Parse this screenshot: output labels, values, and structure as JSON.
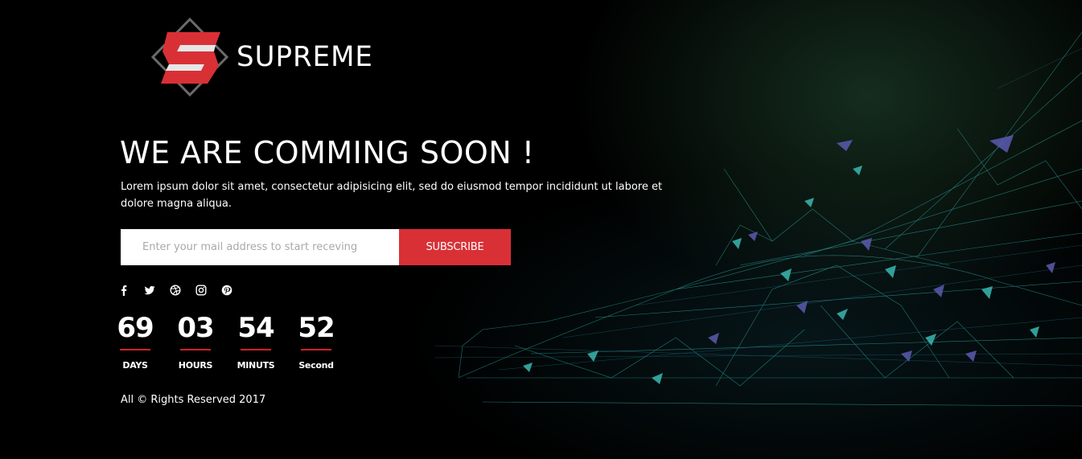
{
  "brand": {
    "name": "SUPREME",
    "logo_icon": "supreme-s-logo",
    "accent": "#d93036"
  },
  "hero": {
    "headline": "WE ARE COMMING SOON !",
    "intro": "Lorem ipsum dolor sit amet, consectetur adipisicing elit, sed do eiusmod tempor incididunt ut labore et dolore magna aliqua."
  },
  "subscribe": {
    "placeholder": "Enter your mail address to start receving",
    "value": "",
    "button_label": "SUBSCRIBE"
  },
  "social": [
    {
      "icon": "facebook-icon"
    },
    {
      "icon": "twitter-icon"
    },
    {
      "icon": "dribbble-icon"
    },
    {
      "icon": "instagram-icon"
    },
    {
      "icon": "pinterest-icon"
    }
  ],
  "countdown": [
    {
      "value": "69",
      "label": "DAYS"
    },
    {
      "value": "03",
      "label": "HOURS"
    },
    {
      "value": "54",
      "label": "MINUTS"
    },
    {
      "value": "52",
      "label": "Second"
    }
  ],
  "footer": {
    "copyright": "All © Rights Reserved 2017"
  }
}
